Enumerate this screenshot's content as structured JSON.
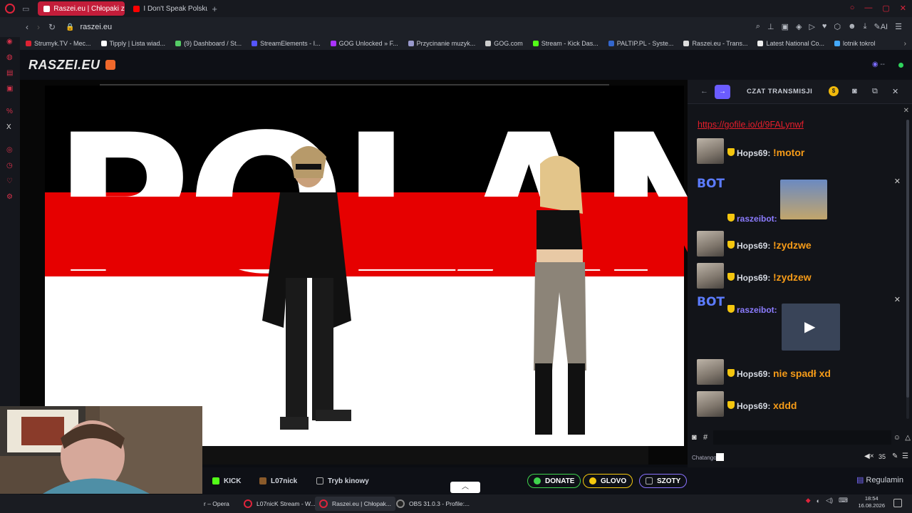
{
  "browser": {
    "tabs": [
      {
        "label": "Raszei.eu | Chłopaki z"
      },
      {
        "label": "I Don't Speak Polsku -"
      }
    ],
    "address": "raszei.eu",
    "bookmarks": [
      "Strumyk.TV - Mec...",
      "Tipply | Lista wiad...",
      "(9) Dashboard / St...",
      "StreamElements - I...",
      "GOG Unlocked » F...",
      "Przycinanie muzyk...",
      "GOG.com",
      "Stream - Kick Das...",
      "PALTIP.PL - Syste...",
      "Raszei.eu - Trans...",
      "Latest National Co...",
      "lotnik tokrol"
    ]
  },
  "site": {
    "logo": "RASZEI.EU",
    "viewer_count": "--"
  },
  "video": {
    "banner_text": "POLAND"
  },
  "controls": {
    "kick": "KICK",
    "user": "L07nick",
    "cinema": "Tryb kinowy",
    "donate": "DONATE",
    "glovo": "GLOVO",
    "szoty": "SZOTY",
    "regulamin": "Regulamin"
  },
  "chat": {
    "title": "CZAT TRANSMISJI",
    "link": "https://gofile.io/d/9FALynwf",
    "messages": [
      {
        "user": "Hops69:",
        "text": "!motor"
      },
      {
        "user": "raszeibot:",
        "text": ""
      },
      {
        "user": "Hops69:",
        "text": "!zydzwe"
      },
      {
        "user": "Hops69:",
        "text": "!zydzew"
      },
      {
        "user": "raszeibot:",
        "text": ""
      },
      {
        "user": "Hops69:",
        "text": "nie spadł xd"
      },
      {
        "user": "Hops69:",
        "text": "xddd"
      }
    ],
    "bot_label": "BOT",
    "footer_label": "Chatango",
    "volume": "35"
  },
  "taskbar": {
    "items": [
      {
        "label": "r – Opera"
      },
      {
        "label": "L07nicK Stream - W..."
      },
      {
        "label": "Raszei.eu | Chłopak..."
      },
      {
        "label": "OBS 31.0.3 - Profile:..."
      }
    ],
    "time": "18:54",
    "date": "16.08.2026"
  },
  "colors": {
    "accent_red": "#e0243b",
    "chat_orange": "#f59b18",
    "purple": "#6b5cff"
  }
}
